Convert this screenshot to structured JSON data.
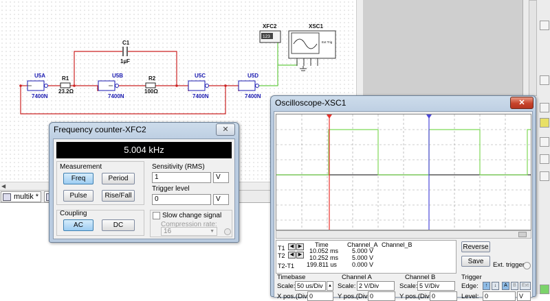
{
  "schematic": {
    "gates": [
      {
        "ref": "U5A",
        "part": "7400N"
      },
      {
        "ref": "U5B",
        "part": "7400N"
      },
      {
        "ref": "U5C",
        "part": "7400N"
      },
      {
        "ref": "U5D",
        "part": "7400N"
      }
    ],
    "r1": {
      "ref": "R1",
      "value": "23.2Ω"
    },
    "r2": {
      "ref": "R2",
      "value": "100Ω"
    },
    "c1": {
      "ref": "C1",
      "value": "1µF"
    },
    "xfc2": {
      "ref": "XFC2",
      "display": "123"
    },
    "xsc1": {
      "ref": "XSC1",
      "ext_trig": "Ext Trig"
    }
  },
  "tabs": [
    {
      "label": "multik *"
    },
    {
      "label": "D"
    }
  ],
  "freq_counter": {
    "title": "Frequency counter-XFC2",
    "reading": "5.004 kHz",
    "measurement_label": "Measurement",
    "buttons": {
      "freq": "Freq",
      "period": "Period",
      "pulse": "Pulse",
      "rise_fall": "Rise/Fall"
    },
    "coupling_label": "Coupling",
    "coupling": {
      "ac": "AC",
      "dc": "DC"
    },
    "sensitivity_label": "Sensitivity (RMS)",
    "sensitivity_value": "1",
    "sensitivity_unit": "V",
    "trigger_label": "Trigger level",
    "trigger_value": "0",
    "trigger_unit": "V",
    "slow_change_label": "Slow change signal",
    "compression_label": "Compression rate:",
    "compression_value": "16"
  },
  "oscilloscope": {
    "title": "Oscilloscope-XSC1",
    "headers": {
      "time": "Time",
      "channel_a": "Channel_A",
      "channel_b": "Channel_B"
    },
    "rows": [
      {
        "label": "T1",
        "time": "10.052 ms",
        "a": "5.000 V"
      },
      {
        "label": "T2",
        "time": "10.252 ms",
        "a": "5.000 V"
      },
      {
        "label": "T2-T1",
        "time": "199.811 us",
        "a": "0.000 V"
      }
    ],
    "reverse": "Reverse",
    "save": "Save",
    "ext_trigger": "Ext. trigger",
    "timebase": {
      "label": "Timebase",
      "scale_label": "Scale:",
      "scale": "50 us/Div",
      "xpos_label": "X pos.(Div):",
      "xpos": "0"
    },
    "channel_a": {
      "label": "Channel A",
      "scale_label": "Scale:",
      "scale": "2 V/Div",
      "ypos_label": "Y pos.(Div):",
      "ypos": "0"
    },
    "channel_b": {
      "label": "Channel B",
      "scale_label": "Scale:",
      "scale": "5 V/Div",
      "ypos_label": "Y pos.(Div):",
      "ypos": "0"
    },
    "trigger": {
      "label": "Trigger",
      "edge_label": "Edge:",
      "level_label": "Level:",
      "level": "0",
      "level_unit": "V",
      "sources": [
        "A",
        "B",
        "Ext"
      ]
    },
    "trace_color": "#7ed957",
    "cursor1_color": "#e8302a",
    "cursor2_color": "#4a46d8"
  }
}
